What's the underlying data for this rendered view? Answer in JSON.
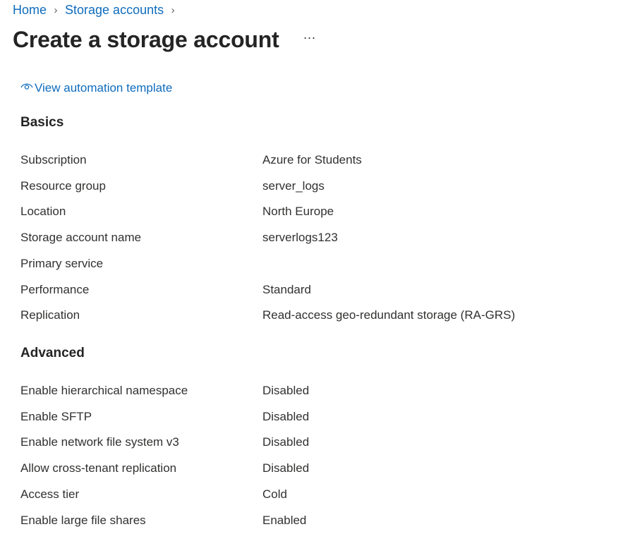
{
  "breadcrumb": {
    "items": [
      "Home",
      "Storage accounts"
    ],
    "separator": "›"
  },
  "header": {
    "title": "Create a storage account",
    "more_label": "···"
  },
  "automation": {
    "link_label": "View automation template",
    "icon": "eye-icon"
  },
  "basics": {
    "heading": "Basics",
    "rows": [
      {
        "label": "Subscription",
        "value": "Azure for Students"
      },
      {
        "label": "Resource group",
        "value": "server_logs"
      },
      {
        "label": "Location",
        "value": "North Europe"
      },
      {
        "label": "Storage account name",
        "value": "serverlogs123"
      },
      {
        "label": "Primary service",
        "value": ""
      },
      {
        "label": "Performance",
        "value": "Standard"
      },
      {
        "label": "Replication",
        "value": "Read-access geo-redundant storage (RA-GRS)"
      }
    ]
  },
  "advanced": {
    "heading": "Advanced",
    "rows": [
      {
        "label": "Enable hierarchical namespace",
        "value": "Disabled"
      },
      {
        "label": "Enable SFTP",
        "value": "Disabled"
      },
      {
        "label": "Enable network file system v3",
        "value": "Disabled"
      },
      {
        "label": "Allow cross-tenant replication",
        "value": "Disabled"
      },
      {
        "label": "Access tier",
        "value": "Cold"
      },
      {
        "label": "Enable large file shares",
        "value": "Enabled"
      }
    ]
  },
  "colors": {
    "link": "#0f6cbd",
    "text": "#323130",
    "heading": "#242424"
  }
}
